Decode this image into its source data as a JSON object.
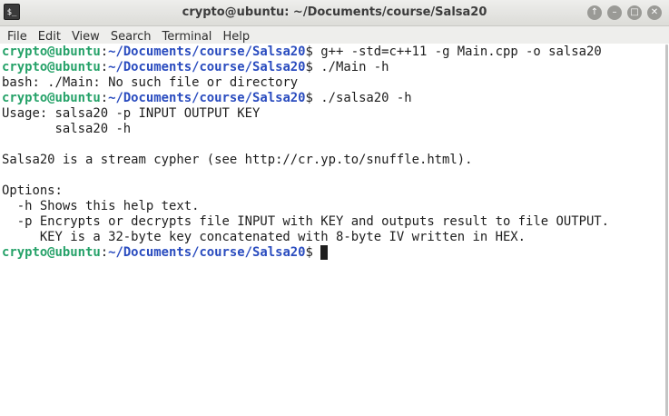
{
  "window": {
    "title": "crypto@ubuntu: ~/Documents/course/Salsa20",
    "app_icon": "$_",
    "controls": {
      "up": "↑",
      "minimize": "–",
      "maximize": "□",
      "close": "✕"
    }
  },
  "menu": [
    "File",
    "Edit",
    "View",
    "Search",
    "Terminal",
    "Help"
  ],
  "prompt": {
    "user": "crypto@ubuntu",
    "path": "~/Documents/course/Salsa20"
  },
  "lines": [
    {
      "type": "cmd",
      "text": "$ g++ -std=c++11 -g Main.cpp -o salsa20"
    },
    {
      "type": "cmd",
      "text": "$ ./Main -h"
    },
    {
      "type": "out",
      "text": "bash: ./Main: No such file or directory"
    },
    {
      "type": "cmd",
      "text": "$ ./salsa20 -h"
    },
    {
      "type": "out",
      "text": "Usage: salsa20 -p INPUT OUTPUT KEY"
    },
    {
      "type": "out",
      "text": "       salsa20 -h"
    },
    {
      "type": "out",
      "text": ""
    },
    {
      "type": "out",
      "text": "Salsa20 is a stream cypher (see http://cr.yp.to/snuffle.html)."
    },
    {
      "type": "out",
      "text": ""
    },
    {
      "type": "out",
      "text": "Options:"
    },
    {
      "type": "out",
      "text": "  -h Shows this help text."
    },
    {
      "type": "out",
      "text": "  -p Encrypts or decrypts file INPUT with KEY and outputs result to file OUTPUT."
    },
    {
      "type": "out",
      "text": "     KEY is a 32-byte key concatenated with 8-byte IV written in HEX."
    },
    {
      "type": "cmd",
      "text": "$ ",
      "cursor": true
    }
  ],
  "colors": {
    "prompt_user": "#26a269",
    "prompt_path": "#2a4cbf",
    "text": "#1e1e1e",
    "background": "#ffffff"
  }
}
